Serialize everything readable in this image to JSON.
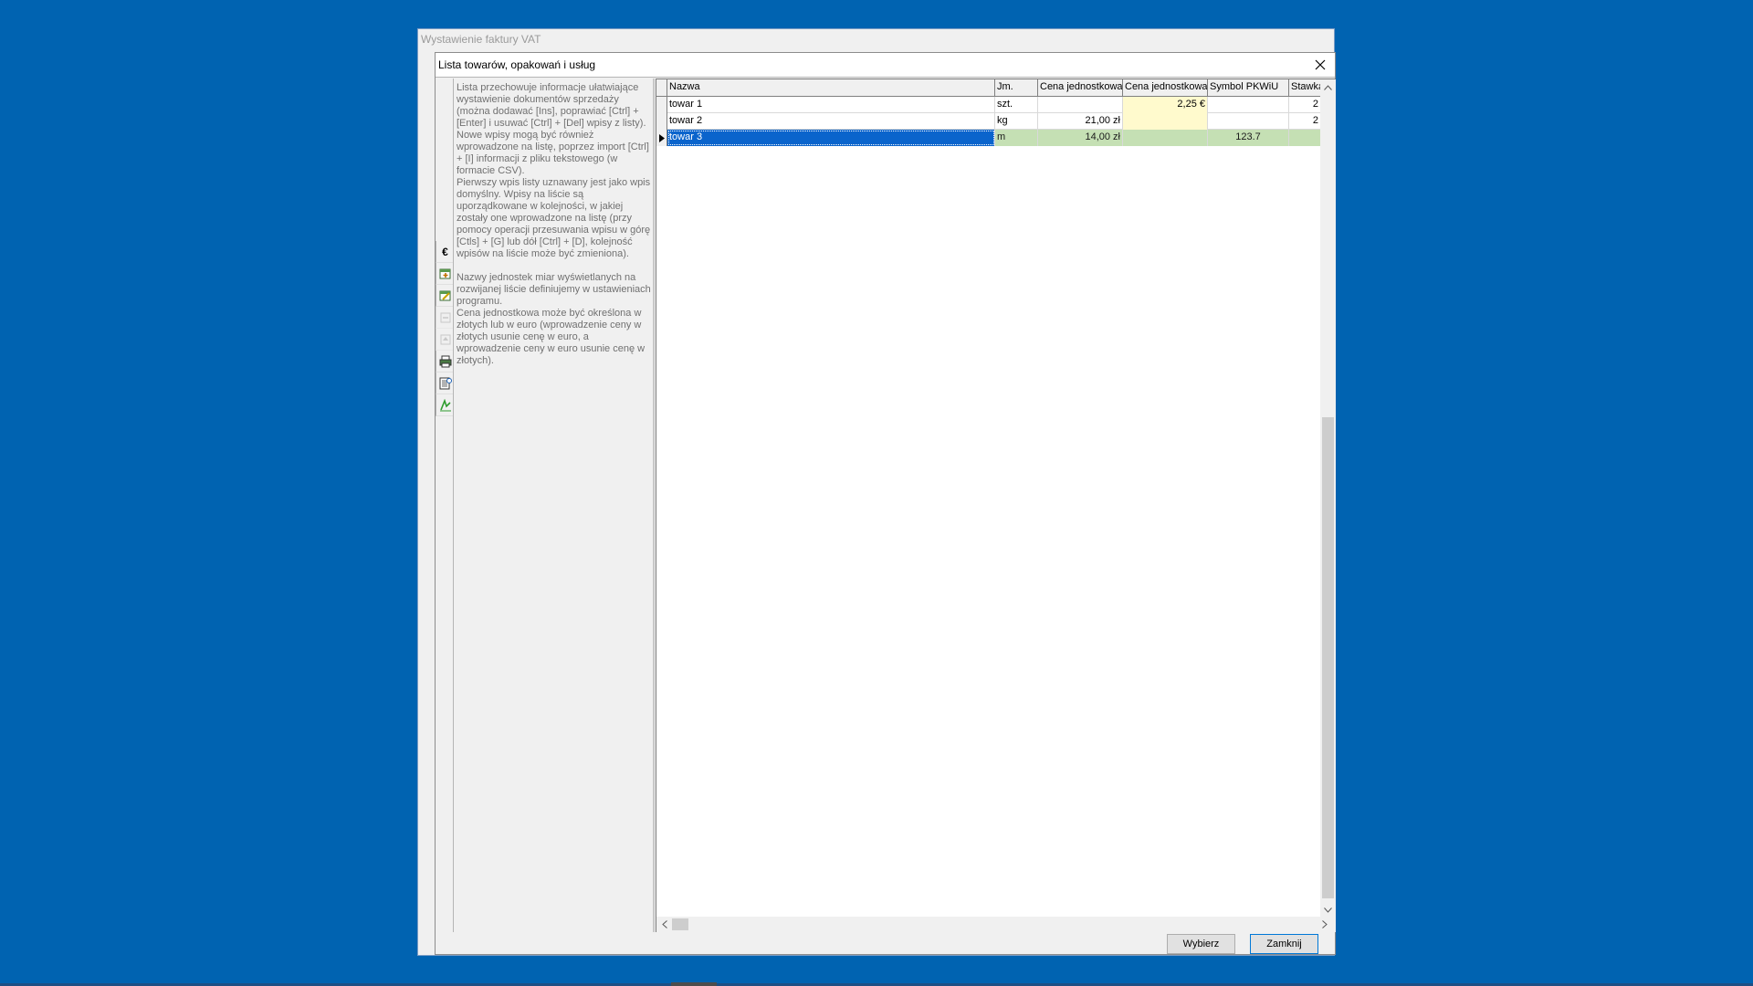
{
  "app": {
    "title": "Wystawienie faktury VAT"
  },
  "dialog": {
    "title": "Lista towarów, opakowań i usług",
    "close_icon": "close-icon"
  },
  "toolbar": {
    "items": [
      {
        "icon": "euro-icon",
        "glyph": "€",
        "enabled": true
      },
      {
        "icon": "add-record-icon",
        "enabled": true
      },
      {
        "icon": "edit-record-icon",
        "enabled": true
      },
      {
        "icon": "delete-record-icon",
        "enabled": false
      },
      {
        "icon": "move-up-icon",
        "enabled": false
      },
      {
        "icon": "print-icon",
        "enabled": true
      },
      {
        "icon": "import-csv-icon",
        "enabled": true
      },
      {
        "icon": "export-icon",
        "enabled": true
      }
    ]
  },
  "info": {
    "paragraph1": "Lista przechowuje informacje ułatwiające wystawienie dokumentów sprzedaży (można dodawać [Ins], poprawiać [Ctrl] + [Enter] i usuwać [Ctrl] + [Del] wpisy z listy).",
    "paragraph2": "Nowe wpisy mogą być również wprowadzone na listę, poprzez import [Ctrl] + [I] informacji z pliku tekstowego (w formacie CSV).",
    "paragraph3": "Pierwszy wpis listy uznawany jest jako wpis domyślny. Wpisy na liście są uporządkowane w kolejności, w jakiej zostały one wprowadzone na listę (przy pomocy operacji przesuwania wpisu w górę [Ctls] + [G] lub dół [Ctrl] + [D], kolejność wpisów na liście może być zmieniona).",
    "paragraph4": "Nazwy jednostek miar wyświetlanych na rozwijanej liście definiujemy w ustawieniach programu.",
    "paragraph5": "Cena jednostkowa może być określona w złotych lub w euro (wprowadzenie ceny w złotych usunie cenę w euro, a wprowadzenie ceny w euro usunie cenę w złotych)."
  },
  "grid": {
    "headers": {
      "name": "Nazwa",
      "unit": "Jm.",
      "price_pln": "Cena jednostkowa",
      "price_eur": "Cena jednostkowa",
      "pkwiu": "Symbol PKWiU",
      "vat": "Stawka V"
    },
    "rows": [
      {
        "name": "towar 1",
        "unit": "szt.",
        "price_pln": "",
        "price_eur": "2,25 €",
        "pkwiu": "",
        "vat": "2",
        "selected": false
      },
      {
        "name": "towar 2",
        "unit": "kg",
        "price_pln": "21,00 zł",
        "price_eur": "",
        "pkwiu": "",
        "vat": "2",
        "selected": false
      },
      {
        "name": "towar 3",
        "unit": "m",
        "price_pln": "14,00 zł",
        "price_eur": "",
        "pkwiu": "123.7",
        "vat": "",
        "selected": true
      }
    ]
  },
  "buttons": {
    "select": "Wybierz",
    "close": "Zamknij"
  },
  "colors": {
    "desktop": "#0063b1",
    "selection": "#0a64cc",
    "selected_row": "#c5e0b4",
    "euro_cell": "#fffacd"
  }
}
